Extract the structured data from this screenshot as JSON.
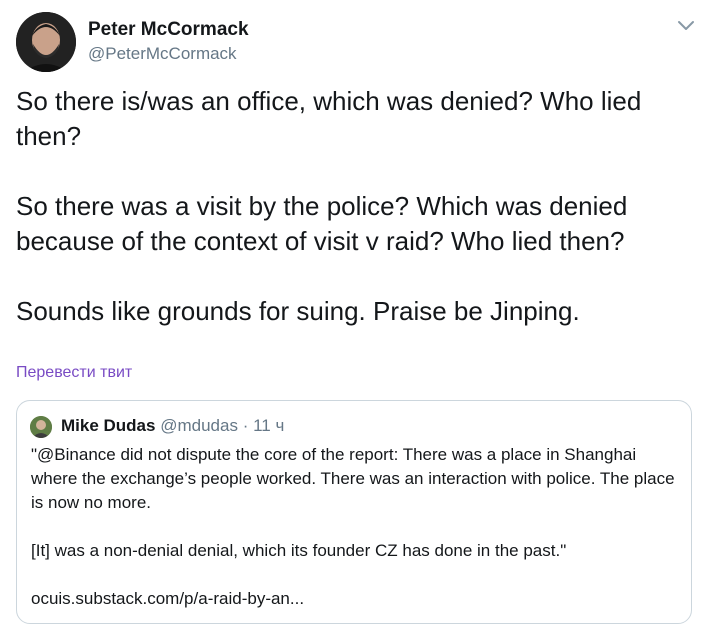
{
  "author": {
    "name": "Peter McCormack",
    "handle": "@PeterMcCormack"
  },
  "tweet": {
    "paragraphs": [
      "So there is/was an office, which was denied? Who lied then?",
      "So there was a visit by the police? Which was denied because of the context of visit v raid? Who lied then?",
      "Sounds like grounds for suing. Praise be Jinping."
    ],
    "translate_label": "Перевести твит"
  },
  "quote": {
    "name": "Mike Dudas",
    "handle": "@mdudas",
    "separator": "·",
    "time": "11 ч",
    "paragraphs": [
      "\"@Binance did not dispute the core of the report: There was a place in Shanghai where the exchange’s people worked. There was an interaction with police. The place is now no more.",
      "[It] was a non-denial denial, which its founder CZ has done in the past.\"",
      "ocuis.substack.com/p/a-raid-by-an..."
    ]
  },
  "icons": {
    "more": "chevron-down-icon",
    "accent_color": "#794bc4",
    "secondary_text_color": "#657786",
    "border_color": "#ccd6dd"
  }
}
